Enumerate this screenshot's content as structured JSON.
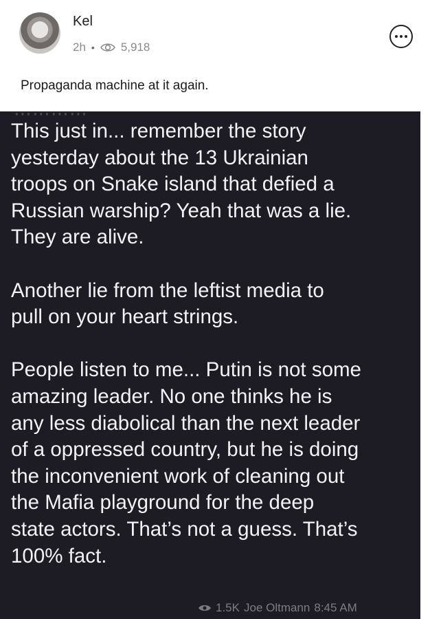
{
  "post": {
    "author": "Kel",
    "time": "2h",
    "separator": "•",
    "views": "5,918",
    "caption": "Propaganda machine at it again."
  },
  "icons": {
    "views": "eye-icon",
    "menu": "more-options-icon",
    "footer": "eye-icon"
  },
  "screenshot": {
    "cut_text": "⋯⋯⋯⋯",
    "body": "This just in... remember the story\nyesterday about the 13 Ukrainian\ntroops on Snake island that defied a\nRussian warship? Yeah that was a lie.\nThey are alive.\n\nAnother lie from the leftist media to\npull on your heart strings.\n\nPeople listen to me... Putin is not some\namazing leader. No one thinks he is\nany less diabolical than the next leader\nof a oppressed country, but he is doing\nthe inconvenient work of cleaning out\nthe Mafia playground for the deep\nstate actors. That’s not a guess. That’s\n100% fact.",
    "footer_views": "1.5K",
    "footer_name": "Joe Oltmann",
    "footer_time": "8:45 AM"
  },
  "colors": {
    "screenshot_bg": "#1d1c25",
    "screenshot_text": "#f3f3f5",
    "meta_gray": "#8a8a8e"
  }
}
